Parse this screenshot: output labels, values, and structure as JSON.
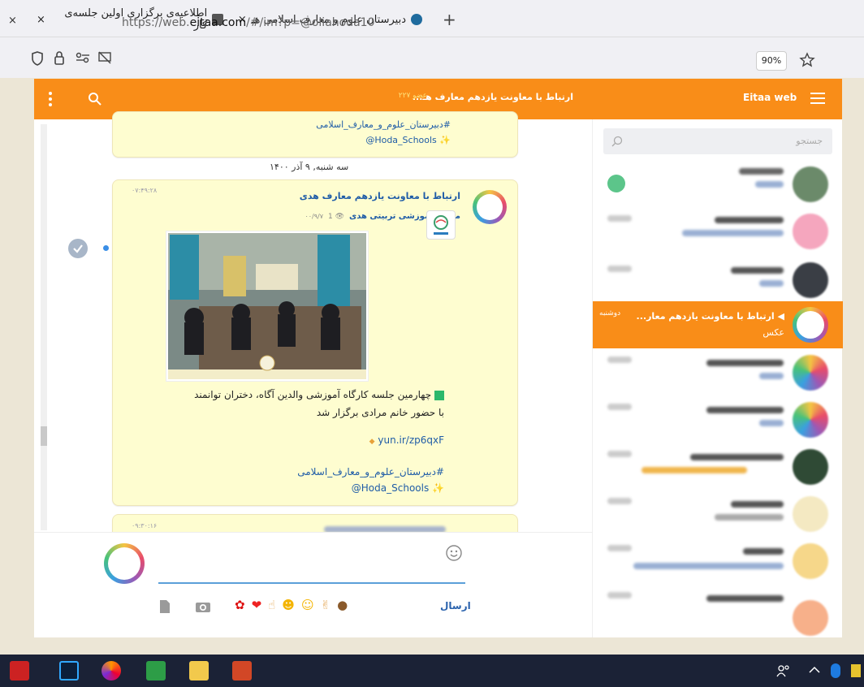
{
  "browser": {
    "tabs": [
      {
        "title": "دبیرستان علوم و معارف اسلامی هـ"
      },
      {
        "title": "اطلاعیه‌ی برگزاری اولین جلسه‌ی کار"
      }
    ],
    "tab_close": "×",
    "new_tab": "+",
    "url_prefix": "https://web.",
    "url_domain": "eitaa.com",
    "url_rest": "/#/im?p=@oliahoda10",
    "zoom": "90%"
  },
  "header": {
    "app_name": "Eitaa web",
    "chat_title": "ارتباط با معاونت یازدهم معارف هـ...",
    "members": "عضو ۲۲۷"
  },
  "sidebar": {
    "search_placeholder": "جستجو",
    "active_chat": {
      "name": "ارتباط با معاونت یازدهم معار...",
      "day": "دوشنبه",
      "preview": "عکس"
    }
  },
  "chat": {
    "prev_hashtag": "#دبیرستان_علوم_و_معارف_اسلامی",
    "prev_handle": "@Hoda_Schools",
    "date_divider": "سه شنبه, ۹ آذر ۱۴۰۰",
    "message": {
      "time": "۰۷:۴۹:۲۸",
      "channel": "ارتباط با معاونت یازدهم معارف هدی",
      "fwd_from": "مجتمع آموزشی تربیتی هدی",
      "fwd_date": "۰۰/۹/۷",
      "views": "1",
      "text_line1": "چهارمین جلسه کارگاه آموزشی والدین آگاه، دختران توانمند",
      "text_line2": "با حضور خانم مرادی برگزار شد",
      "link": "yun.ir/zp6qxF",
      "hashtag": "#دبیرستان_علوم_و_معارف_اسلامی",
      "handle": "@Hoda_Schools"
    },
    "next_time": "۰۹:۳۰:۱۶"
  },
  "composer": {
    "send_label": "ارسال"
  },
  "colors": {
    "header_orange": "#f98d18",
    "bubble_yellow": "#fefdd0",
    "link_blue": "#1f5ca7",
    "taskbar": "#1b2236"
  }
}
